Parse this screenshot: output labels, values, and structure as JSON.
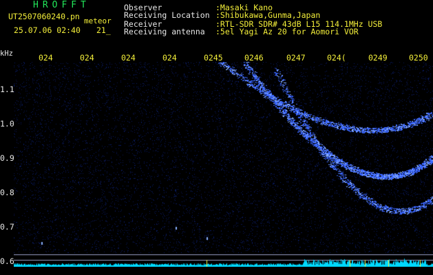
{
  "header": {
    "app_title": "HROFFT",
    "file_name": "UT2507060240.pn",
    "tag": "meteor",
    "date_time": "25.07.06 02:40",
    "count": "21_"
  },
  "info": [
    {
      "key": "Observer",
      "value": ":Masaki Kano"
    },
    {
      "key": "Receiving Location",
      "value": ":Shibukawa,Gunma,Japan"
    },
    {
      "key": "Receiver",
      "value": ":RTL-SDR SDR# 43dB L15 114.1MHz USB"
    },
    {
      "key": "Receiving antenna",
      "value": ":5el Yagi Az 20 for Aomori VOR"
    }
  ],
  "axis": {
    "y_unit": "kHz",
    "y_ticks": [
      "1.1",
      "1.0",
      "0.9",
      "0.8",
      "0.7",
      "0.6"
    ],
    "x_ticks": [
      "024",
      "024",
      "024",
      "024",
      "0245",
      "0246",
      "0247",
      "024(",
      "0249",
      "0250"
    ]
  },
  "colors": {
    "background": "#000000",
    "noise": "#0a1a5a",
    "trace": "#3a66ff",
    "trace_bright": "#8ab0ff",
    "baseline": "#00d8ff",
    "marker": "#f5f03a",
    "ref_line": "#9aa0c8"
  }
}
